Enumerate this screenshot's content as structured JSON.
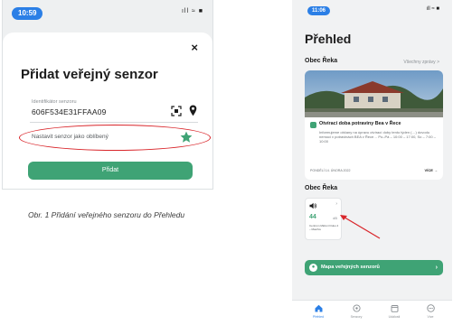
{
  "left_phone": {
    "status_time": "10:59",
    "status_icons": "ıll ≈ ■",
    "close": "×",
    "title": "Přidat veřejný senzor",
    "sensor_id_label": "Identifikátor senzoru",
    "sensor_id_value": "606F534E31FFAA09",
    "favorite_label": "Nastavit senzor jako oblíbený",
    "add_button": "Přidat",
    "caption": "Obr. 1 Přidání veřejného senzoru do Přehledu",
    "icons": [
      "qr-scan-icon",
      "location-pin-icon",
      "star-icon",
      "close-icon"
    ],
    "colors": {
      "accent": "#3fa375",
      "highlight": "#d9252a",
      "time_pill": "#2b7fe6"
    }
  },
  "right_phone": {
    "status_time": "11:06",
    "status_icons": "ıll ≈ ■",
    "title": "Přehled",
    "section_news": "Obec Řeka",
    "all_news_link": "Všechny zprávy >",
    "news": {
      "headline": "Otvírací doba potraviny Bea v Řece",
      "body": "Informujeme občany na úpravu otvírací doby tento týden (…) dovodu nemoci v potravinách BEA v Řece… Po–Pá – 10:00 – 17:00, So – 7:00 – 10:00",
      "date": "PONDĚLÍ 14. ÚNORA 2022",
      "more": "VÍCE →"
    },
    "section_sensors": "Obec Řeka",
    "sensor_card": {
      "value": "44",
      "unit": "dB",
      "more": "›",
      "name": "Centrum Měření hluku 4 – Masiřov"
    },
    "map_button": "Mapa veřejných senzorů",
    "map_button_arrow": "›",
    "tabs": [
      {
        "label": "Přehled",
        "icon": "home-icon"
      },
      {
        "label": "Senzory",
        "icon": "sensors-icon"
      },
      {
        "label": "Události",
        "icon": "calendar-icon"
      },
      {
        "label": "Více",
        "icon": "more-icon"
      }
    ]
  }
}
